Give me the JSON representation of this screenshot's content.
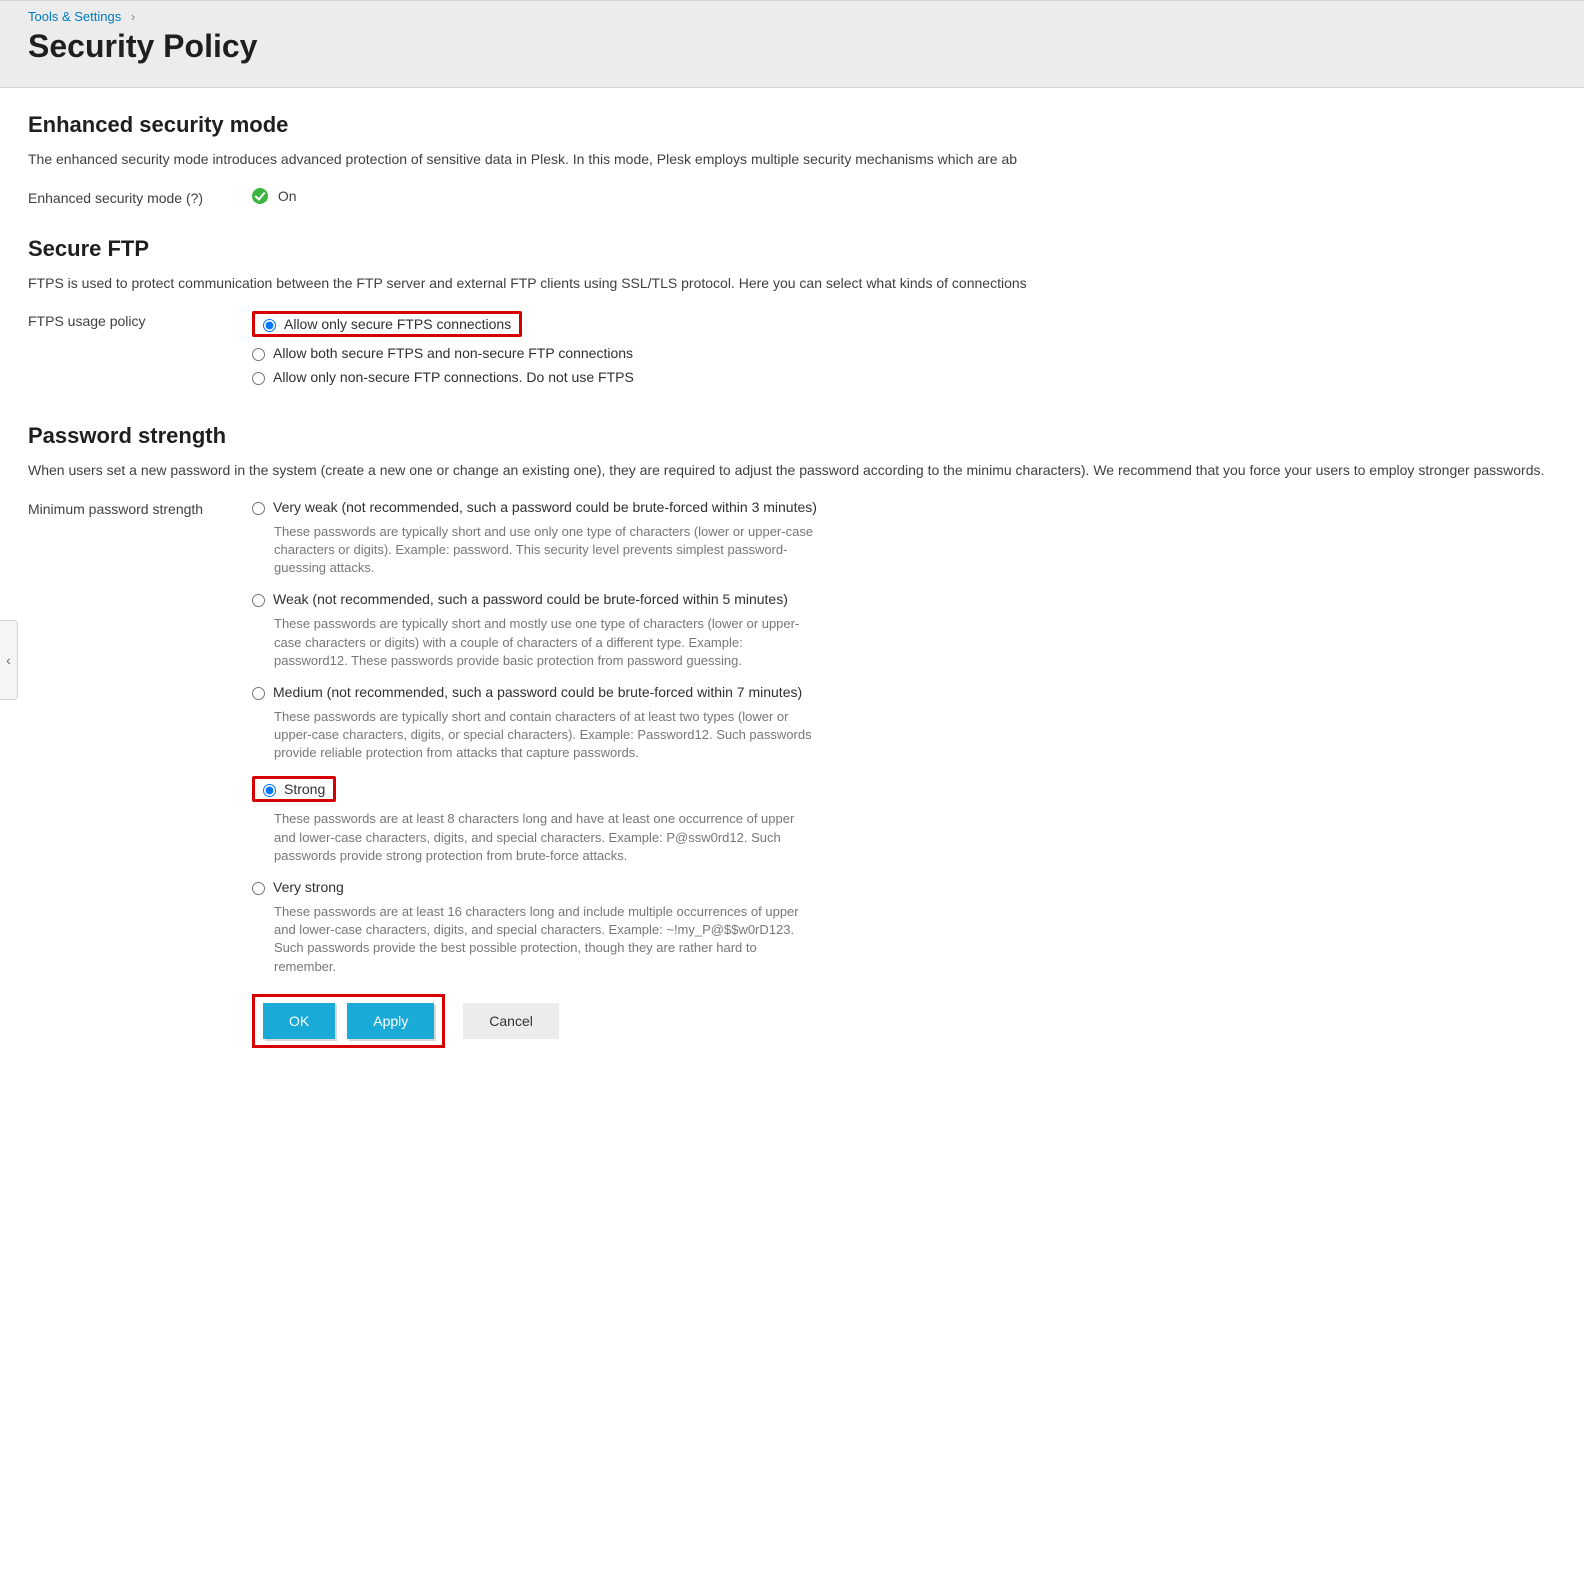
{
  "breadcrumb": {
    "link": "Tools & Settings"
  },
  "title": "Security Policy",
  "sections": {
    "enhanced": {
      "heading": "Enhanced security mode",
      "desc": "The enhanced security mode introduces advanced protection of sensitive data in Plesk. In this mode, Plesk employs multiple security mechanisms which are ab",
      "field_label": "Enhanced security mode (?)",
      "status": "On"
    },
    "ftp": {
      "heading": "Secure FTP",
      "desc": "FTPS is used to protect communication between the FTP server and external FTP clients using SSL/TLS protocol. Here you can select what kinds of connections",
      "field_label": "FTPS usage policy",
      "options": [
        "Allow only secure FTPS connections",
        "Allow both secure FTPS and non-secure FTP connections",
        "Allow only non-secure FTP connections. Do not use FTPS"
      ]
    },
    "password": {
      "heading": "Password strength",
      "desc": "When users set a new password in the system (create a new one or change an existing one), they are required to adjust the password according to the minimu characters). We recommend that you force your users to employ stronger passwords.",
      "field_label": "Minimum password strength",
      "options": [
        {
          "label": "Very weak (not recommended, such a password could be brute-forced within 3 minutes)",
          "hint": "These passwords are typically short and use only one type of characters (lower or upper-case characters or digits). Example: password. This security level prevents simplest password-guessing attacks."
        },
        {
          "label": "Weak (not recommended, such a password could be brute-forced within 5 minutes)",
          "hint": "These passwords are typically short and mostly use one type of characters (lower or upper-case characters or digits) with a couple of characters of a different type. Example: password12. These passwords provide basic protection from password guessing."
        },
        {
          "label": "Medium (not recommended, such a password could be brute-forced within 7 minutes)",
          "hint": "These passwords are typically short and contain characters of at least two types (lower or upper-case characters, digits, or special characters). Example: Password12. Such passwords provide reliable protection from attacks that capture passwords."
        },
        {
          "label": "Strong",
          "hint": "These passwords are at least 8 characters long and have at least one occurrence of upper and lower-case characters, digits, and special characters. Example: P@ssw0rd12. Such passwords provide strong protection from brute-force attacks."
        },
        {
          "label": "Very strong",
          "hint": "These passwords are at least 16 characters long and include multiple occurrences of upper and lower-case characters, digits, and special characters. Example: ~!my_P@$$w0rD123. Such passwords provide the best possible protection, though they are rather hard to remember."
        }
      ]
    }
  },
  "buttons": {
    "ok": "OK",
    "apply": "Apply",
    "cancel": "Cancel"
  }
}
